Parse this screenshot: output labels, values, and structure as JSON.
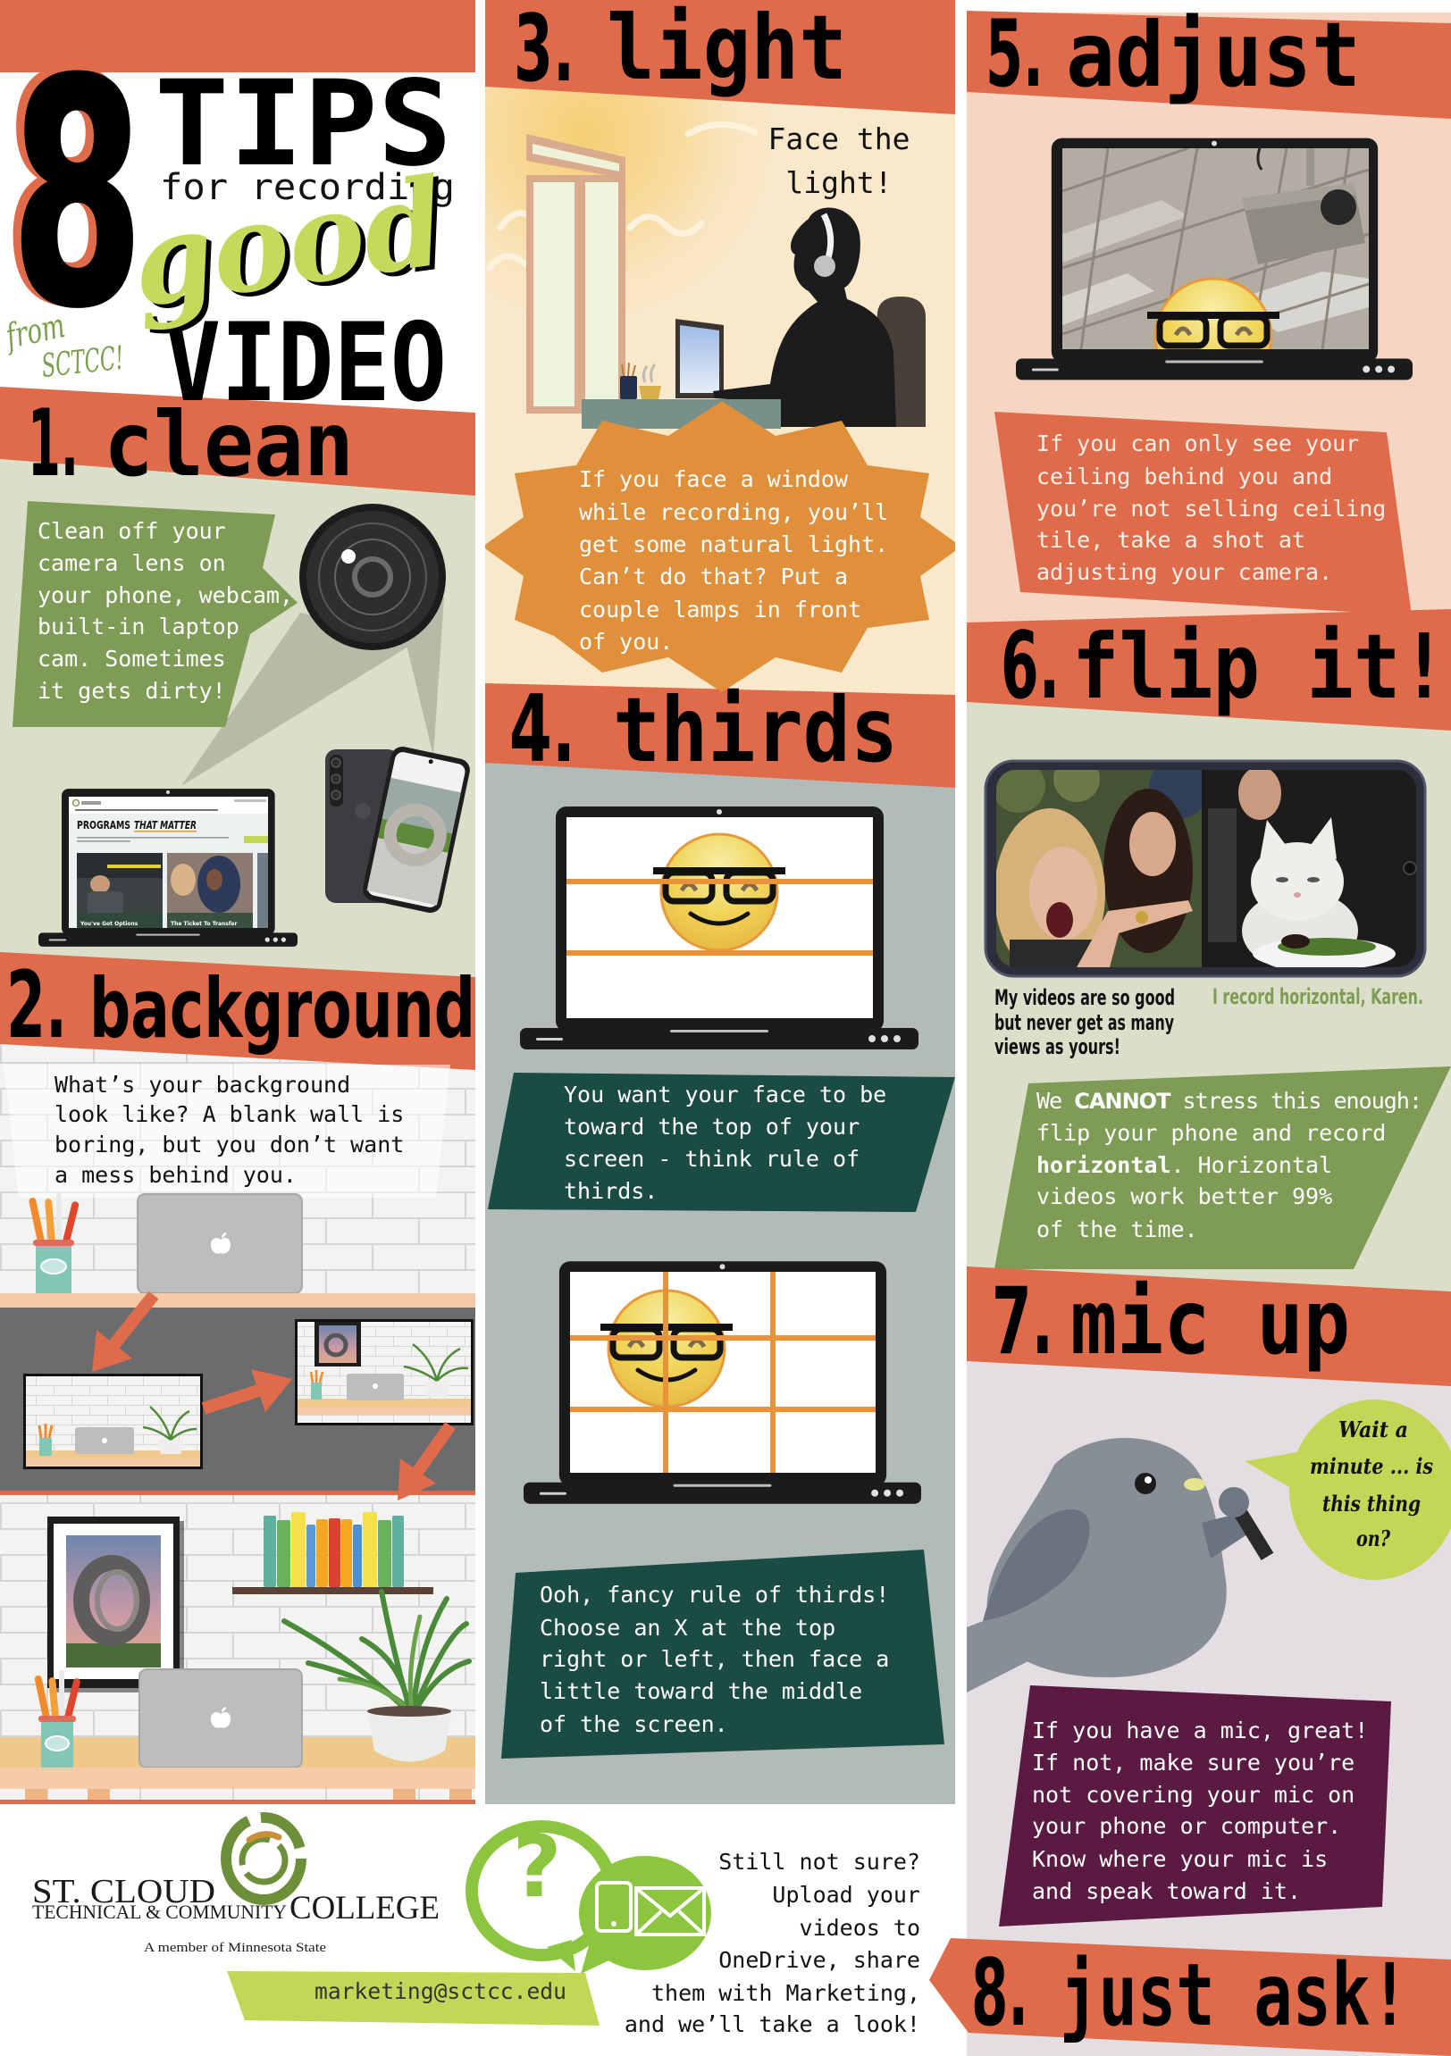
{
  "title": {
    "number": "8",
    "tips": "TIPS",
    "for_recording": "for recording",
    "good": "good",
    "video": "VIDEO",
    "from": "from",
    "org": "SCTCC!"
  },
  "tips": [
    {
      "number": "1.",
      "title": "clean",
      "body": [
        "Clean off your",
        "camera lens on",
        "your phone, webcam,",
        "built-in laptop",
        "cam. Sometimes",
        "it gets dirty!"
      ],
      "laptop_screen": {
        "headline": "PROGRAMS",
        "headline_accent": "THAT MATTER",
        "cards": [
          "You've Got Options",
          "The Ticket To Transfer"
        ]
      }
    },
    {
      "number": "2.",
      "title": "background",
      "body": [
        "What’s your background",
        "look like? A blank wall is",
        "boring, but you don’t want",
        "a mess behind you."
      ]
    },
    {
      "number": "3.",
      "title": "light",
      "callout": [
        "Face the",
        "light!"
      ],
      "body": [
        "If you face a window",
        "while recording, you’ll",
        "get some natural light.",
        "Can’t do that? Put a",
        "couple lamps in front",
        "of you."
      ]
    },
    {
      "number": "4.",
      "title": "thirds",
      "body": [
        "You want your face to be",
        "toward the top of your",
        "screen - think rule of",
        "thirds."
      ],
      "body_advanced": [
        "Ooh, fancy rule of thirds!",
        "Choose an X at the top",
        "right or left, then face a",
        "little toward the middle",
        "of the screen."
      ]
    },
    {
      "number": "5.",
      "title": "adjust",
      "body": [
        "If you can only see your",
        "ceiling behind you and",
        "you’re not selling ceiling",
        "tile, take a shot at",
        "adjusting your camera."
      ]
    },
    {
      "number": "6.",
      "title": "flip it!",
      "meme": {
        "left_caption": [
          "My videos are so good",
          "but never get as many",
          "views as yours!"
        ],
        "right_caption": "I record horizontal, Karen."
      },
      "body": {
        "line1": {
          "before": "We ",
          "emphasis": "CANNOT",
          "after": " stress this enough:"
        },
        "line2": "flip your phone and record",
        "line3": {
          "emphasis": "horizontal",
          "after": ". Horizontal"
        },
        "line4": "videos work better 99%",
        "line5": "of the time."
      }
    },
    {
      "number": "7.",
      "title": "mic up",
      "speech_bubble": [
        "Wait a",
        "minute ... is",
        "this thing",
        "on?"
      ],
      "body": [
        "If you have a mic, great!",
        "If not, make sure you’re",
        "not covering your mic on",
        "your phone or computer.",
        "Know where your mic is",
        "and speak toward it."
      ]
    },
    {
      "number": "8.",
      "title": "just ask!",
      "body": [
        "Still not sure?",
        "Upload your",
        "videos to",
        "OneDrive, share",
        "them with Marketing,",
        "and we’ll take a look!"
      ],
      "email": "marketing@sctcc.edu"
    }
  ],
  "footer": {
    "logo": {
      "name_line1": "ST. CLOUD",
      "name_line2": "TECHNICAL & COMMUNITY",
      "name_line3": "COLLEGE",
      "tagline": "A member of Minnesota State"
    },
    "help_glyph": "?"
  },
  "icons": [
    "camera-lens-icon",
    "laptop-icon",
    "smartphone-icon",
    "sun-icon",
    "emoji-face-icon",
    "apple-logo-icon",
    "microphone-icon",
    "question-bubble-icon",
    "mobile-phone-icon",
    "envelope-icon",
    "arrow-icon"
  ],
  "palette": {
    "orange": "#e06b4a",
    "sage": "#dbdfca",
    "olive_green": "#7e9c55",
    "cream": "#f9e8ca",
    "starburst_orange": "#e08f3a",
    "slate_gray": "#b3bbb9",
    "forest_green": "#1b4c43",
    "peach": "#f6d5c2",
    "lavender": "#e4dde2",
    "plum": "#5a1a42",
    "lime": "#c3d655",
    "charcoal": "#6b6c6e",
    "logo_green": "#6e8f3a"
  }
}
